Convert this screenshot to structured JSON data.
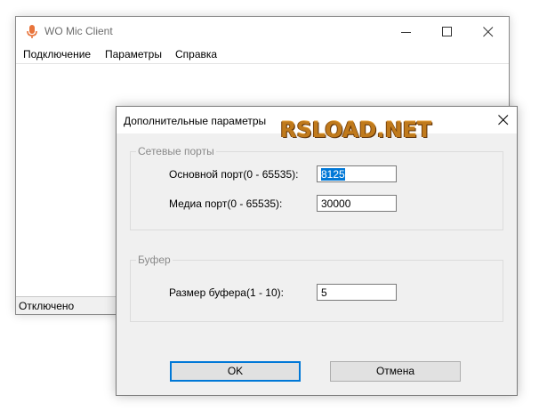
{
  "main_window": {
    "title": "WO Mic Client",
    "icon": "microphone-icon",
    "menu": {
      "connection": "Подключение",
      "parameters": "Параметры",
      "help": "Справка"
    },
    "status": "Отключено"
  },
  "dialog": {
    "title": "Дополнительные параметры",
    "ports_group": {
      "legend": "Сетевые порты",
      "main_port_label": "Основной порт(0 - 65535):",
      "main_port_value": "8125",
      "media_port_label": "Медиа порт(0 - 65535):",
      "media_port_value": "30000"
    },
    "buffer_group": {
      "legend": "Буфер",
      "buffer_size_label": "Размер буфера(1 - 10):",
      "buffer_size_value": "5"
    },
    "ok_label": "OK",
    "cancel_label": "Отмена"
  },
  "watermark": "RSLOAD.NET",
  "colors": {
    "accent": "#0078d7",
    "dialog_bg": "#f0f0f0",
    "watermark": "#c07a1c",
    "app_icon": "#e8743b"
  }
}
